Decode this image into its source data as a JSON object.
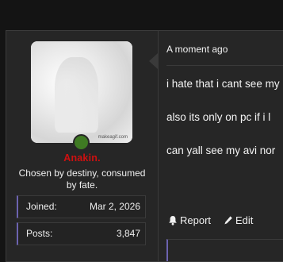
{
  "user": {
    "avatar_watermark": "makeagif.com",
    "name": "Anakin.",
    "title": "Chosen by destiny, consumed by fate.",
    "stats": [
      {
        "label": "Joined:",
        "value": "Mar 2, 2026"
      },
      {
        "label": "Posts:",
        "value": "3,847"
      }
    ],
    "status_color": "#3f7a23",
    "name_color": "#d01010"
  },
  "post": {
    "timestamp": "A moment ago",
    "lines": [
      "i hate that i cant see my",
      "also its only on pc if i l",
      "can yall see my avi nor"
    ],
    "actions": {
      "report": "Report",
      "edit": "Edit"
    }
  }
}
